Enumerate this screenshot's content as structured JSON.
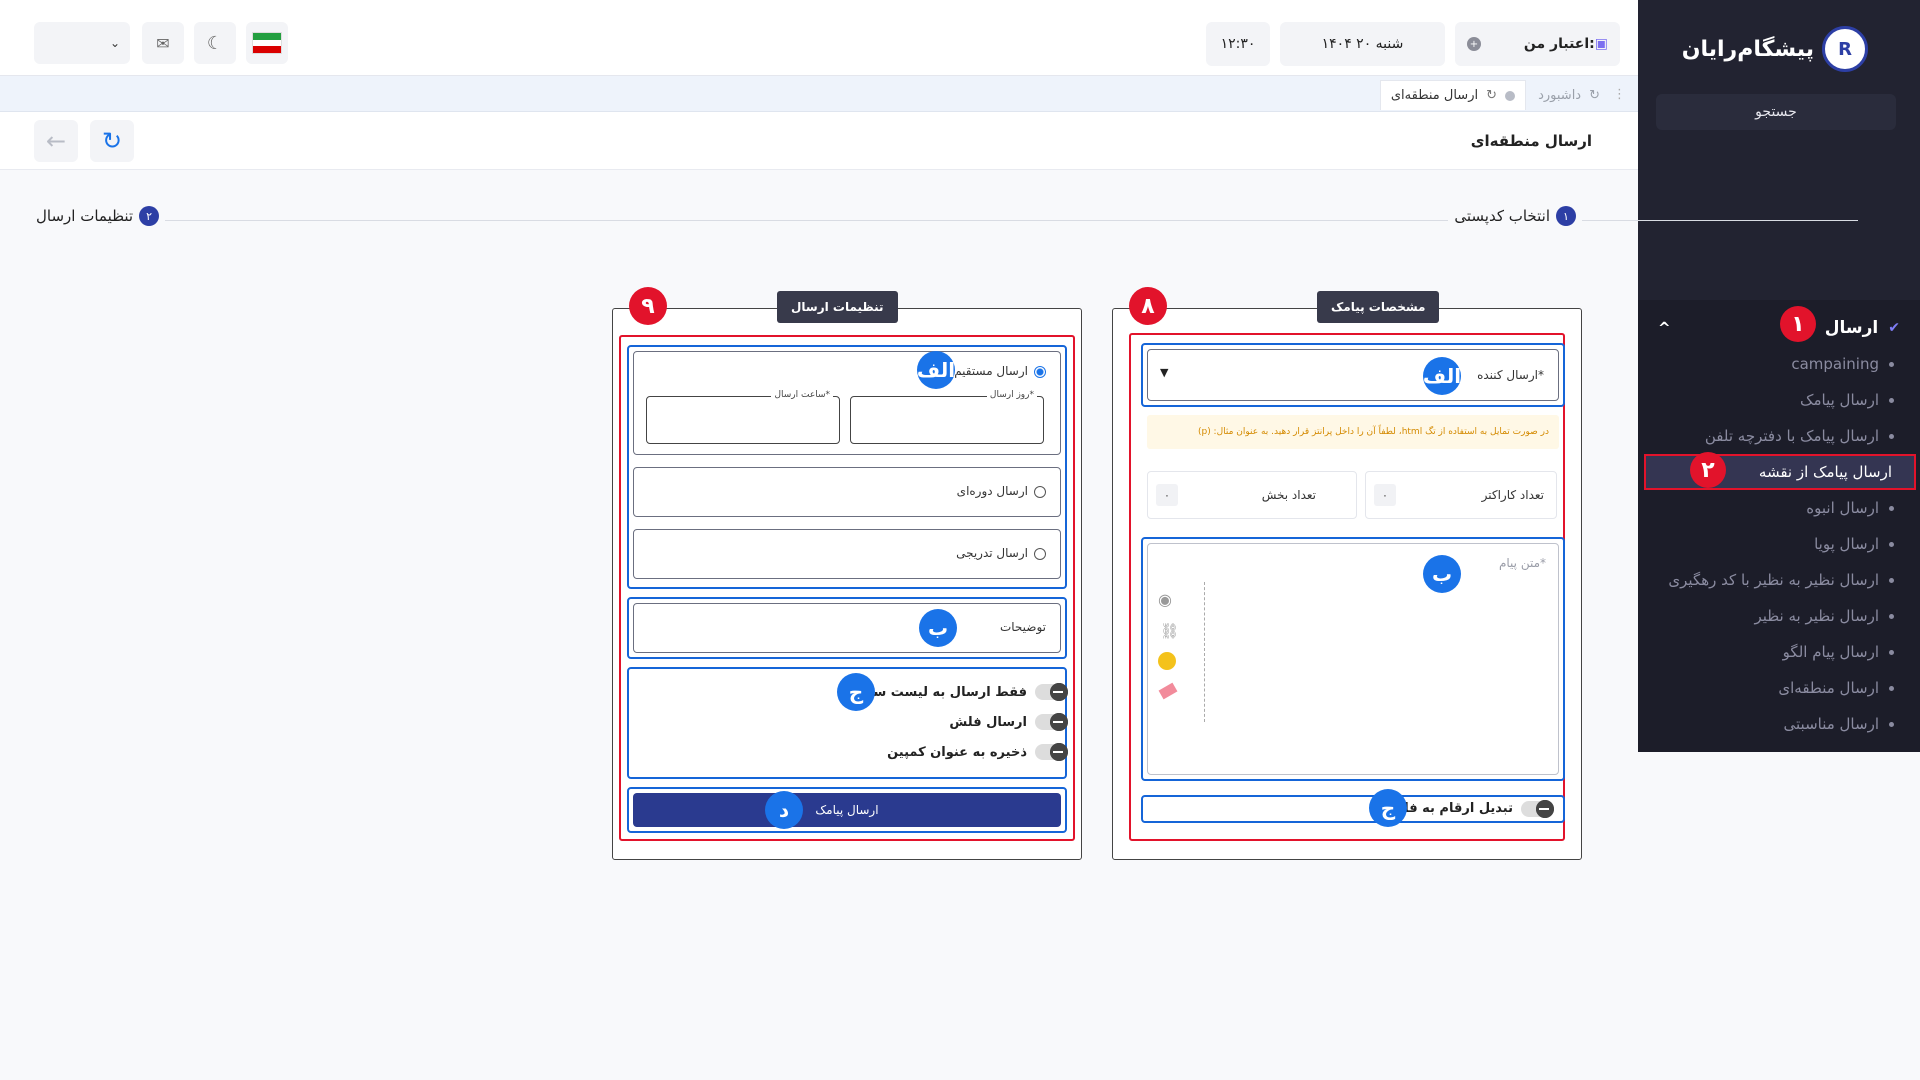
{
  "brand": {
    "name": "پیشگام‌رایان",
    "mark": "R"
  },
  "header": {
    "credit_label": "اعتبار من:",
    "date": "شنبه ۲۰ ۱۴۰۴",
    "time": "۱۲:۳۰"
  },
  "sidebar": {
    "search": "جستجو",
    "menu_title": "ارسال",
    "items": [
      {
        "label": "campaining"
      },
      {
        "label": "ارسال پیامک"
      },
      {
        "label": "ارسال پیامک با دفترچه تلفن"
      },
      {
        "label": "ارسال پیامک از نقشه"
      },
      {
        "label": "ارسال انبوه"
      },
      {
        "label": "ارسال پویا"
      },
      {
        "label": "ارسال نظیر به نظیر با کد رهگیری"
      },
      {
        "label": "ارسال نظیر به نظیر"
      },
      {
        "label": "ارسال پیام الگو"
      },
      {
        "label": "ارسال منطقه‌ای"
      },
      {
        "label": "ارسال مناسبتی"
      }
    ]
  },
  "tabs": [
    {
      "label": "داشبورد"
    },
    {
      "label": "ارسال منطقه‌ای"
    }
  ],
  "page": {
    "title": "ارسال منطقه‌ای"
  },
  "stepper": [
    {
      "num": "۱",
      "label": "انتخاب کدپستی"
    },
    {
      "num": "۲",
      "label": "تنظیمات ارسال"
    }
  ],
  "sms_panel": {
    "tag": "مشخصات پیامک",
    "sender_label": "ارسال کننده*",
    "hint": "در صورت تمایل به استفاده از تگ html، لطفاً آن را داخل پرانتز قرار دهید. به عنوان مثال: (p)",
    "char_count_label": "تعداد کاراکتر",
    "char_count": "۰",
    "parts_label": "تعداد بخش",
    "parts": "۰",
    "text_placeholder": "متن پیام*",
    "persian_digits_label": "تبدیل ارقام به فارسی"
  },
  "send_panel": {
    "tag": "تنظیمات ارسال",
    "direct_label": "ارسال مستقیم",
    "day_label": "روز ارسال*",
    "hour_label": "ساعت ارسال*",
    "periodic_label": "ارسال دوره‌ای",
    "gradual_label": "ارسال تدریجی",
    "description_label": "توضیحات",
    "whitelist_label": "فقط ارسال به لیست سفید",
    "flash_label": "ارسال فلش",
    "save_campaign_label": "ذخیره به عنوان کمپین",
    "submit_label": "ارسال پیامک"
  },
  "annotations": {
    "red": [
      "۱",
      "۲",
      "۸",
      "۹"
    ],
    "blue": [
      "الف",
      "ب",
      "ج",
      "د"
    ]
  },
  "colors": {
    "accent": "#2d3fa5",
    "highlight_red": "#e2132b",
    "annotation_blue": "#1a73e8",
    "sidebar_bg": "#1e1f2c"
  }
}
